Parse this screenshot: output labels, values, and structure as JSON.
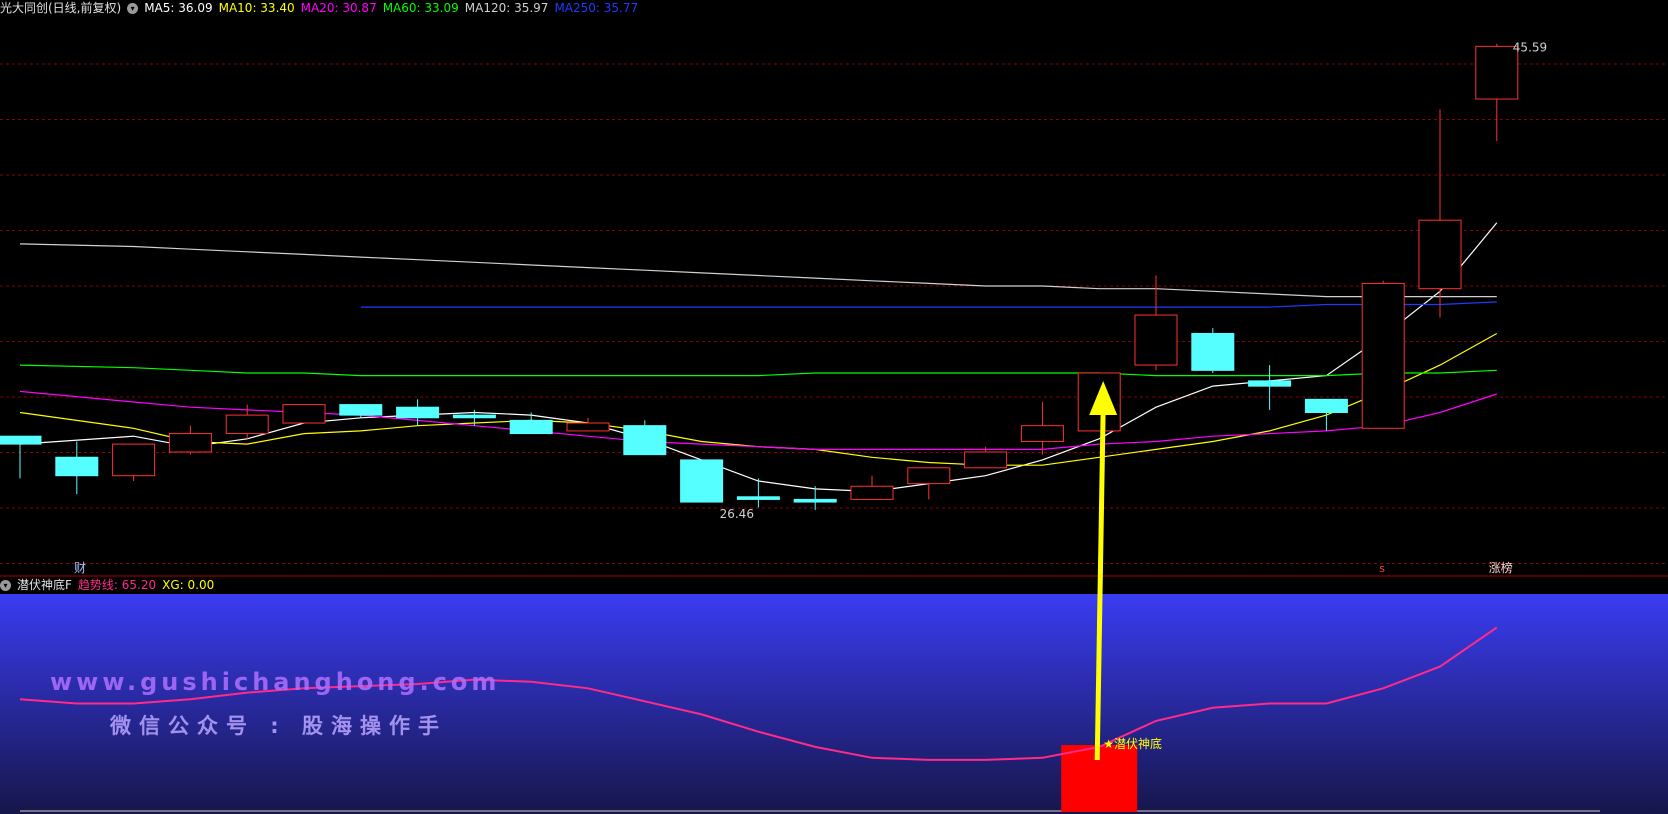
{
  "main_header": {
    "title": "光大同创(日线,前复权)",
    "items": [
      {
        "label": "MA5: 36.09",
        "color": "#ffffff"
      },
      {
        "label": "MA10: 33.40",
        "color": "#ffff00"
      },
      {
        "label": "MA20: 30.87",
        "color": "#ff00ff"
      },
      {
        "label": "MA60: 33.09",
        "color": "#00ff00"
      },
      {
        "label": "MA120: 35.97",
        "color": "#d0d0d0"
      },
      {
        "label": "MA250: 35.77",
        "color": "#1a3cff"
      }
    ]
  },
  "sub_header": {
    "title": "潜伏神底F",
    "items": [
      {
        "label": "趋势线: 65.20",
        "color": "#ff2a8a"
      },
      {
        "label": "XG: 0.00",
        "color": "#ffff00"
      }
    ]
  },
  "annotations": {
    "high_label": "45.59",
    "low_label": "26.46",
    "cai_label": "财",
    "s_label": "s",
    "zhangbang_label": "涨榜",
    "signal_label": "★潜伏神底"
  },
  "watermarks": {
    "url": "www.gushichanghong.com",
    "wechat": "微信公众号 : 股海操作手"
  },
  "colors": {
    "up": "#ff3030",
    "down": "#55ffff",
    "grid": "#8b0000",
    "arrow": "#ffff00",
    "signal_block": "#ff0000",
    "trend_line": "#ff2a8a"
  },
  "chart_data": [
    {
      "type": "candlestick",
      "ylim": [
        26.0,
        46.5
      ],
      "candles": [
        {
          "o": 30.7,
          "c": 30.4,
          "h": 30.4,
          "l": 29.1
        },
        {
          "o": 29.9,
          "c": 29.2,
          "h": 30.5,
          "l": 28.5
        },
        {
          "o": 29.2,
          "c": 30.4,
          "h": 30.4,
          "l": 29.0
        },
        {
          "o": 30.1,
          "c": 30.8,
          "h": 31.1,
          "l": 30.0
        },
        {
          "o": 30.8,
          "c": 31.5,
          "h": 31.9,
          "l": 30.6
        },
        {
          "o": 31.2,
          "c": 31.9,
          "h": 31.9,
          "l": 31.2
        },
        {
          "o": 31.9,
          "c": 31.5,
          "h": 31.9,
          "l": 31.4
        },
        {
          "o": 31.8,
          "c": 31.4,
          "h": 32.1,
          "l": 31.1
        },
        {
          "o": 31.5,
          "c": 31.4,
          "h": 31.7,
          "l": 31.1
        },
        {
          "o": 31.3,
          "c": 30.8,
          "h": 31.6,
          "l": 30.8
        },
        {
          "o": 30.9,
          "c": 31.2,
          "h": 31.4,
          "l": 30.9
        },
        {
          "o": 31.1,
          "c": 30.0,
          "h": 31.3,
          "l": 30.0
        },
        {
          "o": 29.8,
          "c": 28.2,
          "h": 29.8,
          "l": 28.2
        },
        {
          "o": 28.4,
          "c": 28.3,
          "h": 29.1,
          "l": 28.0
        },
        {
          "o": 28.3,
          "c": 28.2,
          "h": 28.8,
          "l": 27.9
        },
        {
          "o": 28.3,
          "c": 28.8,
          "h": 29.2,
          "l": 28.3
        },
        {
          "o": 28.9,
          "c": 29.5,
          "h": 29.5,
          "l": 28.3
        },
        {
          "o": 29.5,
          "c": 30.1,
          "h": 30.3,
          "l": 29.5
        },
        {
          "o": 30.5,
          "c": 31.1,
          "h": 32.0,
          "l": 30.0
        },
        {
          "o": 30.9,
          "c": 33.1,
          "h": 33.1,
          "l": 30.9
        },
        {
          "o": 33.4,
          "c": 35.3,
          "h": 36.8,
          "l": 33.2
        },
        {
          "o": 34.6,
          "c": 33.2,
          "h": 34.8,
          "l": 33.1
        },
        {
          "o": 32.8,
          "c": 32.6,
          "h": 33.4,
          "l": 31.7
        },
        {
          "o": 32.1,
          "c": 31.6,
          "h": 32.1,
          "l": 30.9
        },
        {
          "o": 31.0,
          "c": 36.5,
          "h": 36.6,
          "l": 31.0
        },
        {
          "o": 36.3,
          "c": 38.9,
          "h": 43.1,
          "l": 35.2
        },
        {
          "o": 43.5,
          "c": 45.5,
          "h": 45.6,
          "l": 41.9
        }
      ],
      "ma": {
        "MA5": [
          30.4,
          null,
          30.7,
          30.3,
          30.6,
          31.2,
          31.4,
          31.5,
          31.6,
          31.5,
          31.2,
          30.6,
          29.8,
          29.0,
          28.7,
          28.6,
          28.9,
          29.2,
          29.8,
          30.6,
          31.8,
          32.6,
          32.8,
          33.0,
          34.5,
          36.2,
          38.8
        ],
        "MA10": [
          31.6,
          null,
          31.0,
          30.5,
          30.4,
          30.8,
          30.9,
          31.1,
          31.2,
          31.3,
          31.2,
          30.9,
          30.5,
          30.3,
          30.2,
          29.9,
          29.7,
          29.6,
          29.6,
          29.9,
          30.2,
          30.5,
          30.9,
          31.5,
          32.4,
          33.4,
          34.6
        ],
        "MA20": [
          32.4,
          null,
          32.0,
          31.8,
          31.7,
          31.6,
          31.5,
          31.3,
          31.1,
          30.9,
          30.7,
          30.5,
          30.4,
          30.3,
          30.2,
          30.2,
          30.2,
          30.2,
          30.2,
          30.4,
          30.5,
          30.7,
          30.8,
          30.9,
          31.1,
          31.6,
          32.3
        ],
        "MA60": [
          33.4,
          null,
          33.3,
          33.2,
          33.1,
          33.1,
          33.0,
          33.0,
          33.0,
          33.0,
          33.0,
          33.0,
          33.0,
          33.0,
          33.1,
          33.1,
          33.1,
          33.1,
          33.1,
          33.1,
          33.0,
          33.0,
          33.0,
          33.0,
          33.1,
          33.1,
          33.2
        ],
        "MA120": [
          38.0,
          null,
          37.9,
          37.8,
          37.7,
          37.6,
          37.5,
          37.4,
          37.3,
          37.2,
          37.1,
          37.0,
          36.9,
          36.8,
          36.7,
          36.6,
          36.5,
          36.4,
          36.4,
          36.3,
          36.3,
          36.2,
          36.1,
          36.0,
          36.0,
          36.0,
          36.0
        ],
        "MA250": [
          null,
          null,
          null,
          null,
          null,
          null,
          35.6,
          35.6,
          35.6,
          35.6,
          35.6,
          35.6,
          35.6,
          35.6,
          35.6,
          35.6,
          35.6,
          35.6,
          35.6,
          35.6,
          35.6,
          35.6,
          35.6,
          35.7,
          35.7,
          35.7,
          35.8
        ]
      }
    },
    {
      "type": "line",
      "title": "潜伏神底F",
      "ylim": [
        0,
        100
      ],
      "series": [
        {
          "name": "趋势线",
          "values": [
            52,
            50,
            50,
            52,
            55,
            57,
            58,
            59,
            61,
            60,
            57,
            51,
            45,
            37,
            30,
            25,
            24,
            24,
            25,
            30,
            42,
            48,
            50,
            50,
            57,
            67,
            85
          ]
        }
      ],
      "signal_index": 19
    }
  ]
}
